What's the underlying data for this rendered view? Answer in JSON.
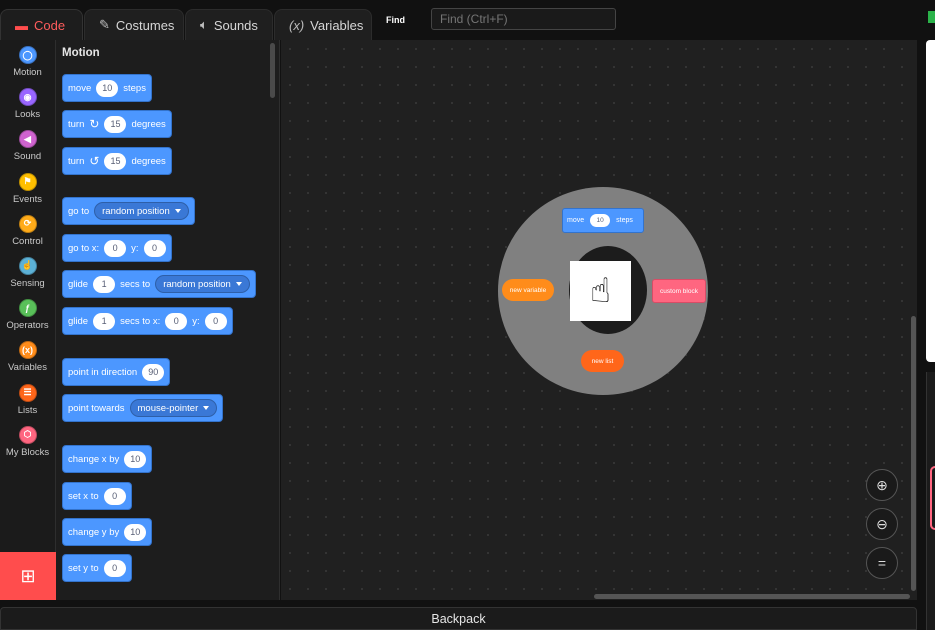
{
  "tabs": [
    {
      "label": "Code",
      "icon": "code-icon",
      "active": true
    },
    {
      "label": "Costumes",
      "icon": "brush-icon",
      "active": false
    },
    {
      "label": "Sounds",
      "icon": "speaker-icon",
      "active": false
    },
    {
      "label": "Variables",
      "icon": "variable-icon",
      "active": false
    }
  ],
  "find": {
    "label": "Find",
    "placeholder": "Find (Ctrl+F)"
  },
  "categories": [
    {
      "label": "Motion",
      "color": "#4c97ff",
      "glyph": "◯"
    },
    {
      "label": "Looks",
      "color": "#9966ff",
      "glyph": "◉"
    },
    {
      "label": "Sound",
      "color": "#cf63cf",
      "glyph": "◀"
    },
    {
      "label": "Events",
      "color": "#ffbf00",
      "glyph": "⚑"
    },
    {
      "label": "Control",
      "color": "#ffab19",
      "glyph": "⟳"
    },
    {
      "label": "Sensing",
      "color": "#5cb1d6",
      "glyph": "☝"
    },
    {
      "label": "Operators",
      "color": "#59c059",
      "glyph": "ƒ"
    },
    {
      "label": "Variables",
      "color": "#ff8c1a",
      "glyph": "(x)"
    },
    {
      "label": "Lists",
      "color": "#ff661a",
      "glyph": "☰"
    },
    {
      "label": "My Blocks",
      "color": "#ff6680",
      "glyph": "⬡"
    }
  ],
  "palette": {
    "title": "Motion",
    "blocks": {
      "move": {
        "pre": "move",
        "value": "10",
        "post": "steps"
      },
      "turn_right": {
        "pre": "turn",
        "value": "15",
        "post": "degrees"
      },
      "turn_left": {
        "pre": "turn",
        "value": "15",
        "post": "degrees"
      },
      "goto": {
        "pre": "go to",
        "dropdown": "random position"
      },
      "goto_xy": {
        "pre": "go to x:",
        "x": "0",
        "mid": "y:",
        "y": "0"
      },
      "glide": {
        "pre": "glide",
        "value": "1",
        "mid": "secs to",
        "dropdown": "random position"
      },
      "glide_xy": {
        "pre": "glide",
        "value": "1",
        "mid": "secs to x:",
        "x": "0",
        "mid2": "y:",
        "y": "0"
      },
      "point_dir": {
        "pre": "point in direction",
        "value": "90"
      },
      "point_towards": {
        "pre": "point towards",
        "dropdown": "mouse-pointer"
      },
      "change_x": {
        "pre": "change x by",
        "value": "10"
      },
      "set_x": {
        "pre": "set x to",
        "value": "0"
      },
      "change_y": {
        "pre": "change y by",
        "value": "10"
      },
      "set_y": {
        "pre": "set y to",
        "value": "0"
      }
    }
  },
  "radial": {
    "move": {
      "pre": "move",
      "value": "10",
      "post": "steps"
    },
    "new_variable": "new variable",
    "custom_block": "custom block",
    "new_list": "new list"
  },
  "backpack": "Backpack"
}
